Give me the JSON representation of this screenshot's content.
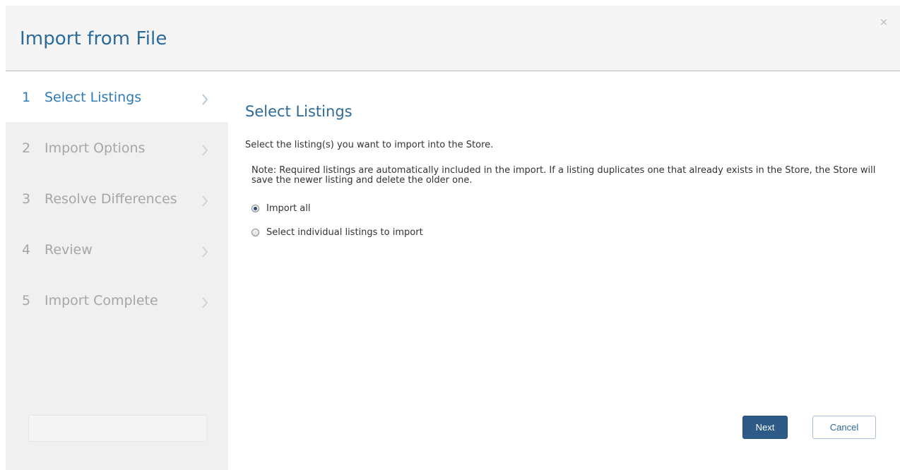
{
  "dialog": {
    "title": "Import from File",
    "close_icon": "close-icon",
    "close_glyph": "×"
  },
  "steps": [
    {
      "number": "1",
      "label": "Select Listings",
      "active": true
    },
    {
      "number": "2",
      "label": "Import Options",
      "active": false
    },
    {
      "number": "3",
      "label": "Resolve Differences",
      "active": false
    },
    {
      "number": "4",
      "label": "Review",
      "active": false
    },
    {
      "number": "5",
      "label": "Import Complete",
      "active": false
    }
  ],
  "content": {
    "title": "Select Listings",
    "intro": "Select the listing(s) you want to import into the Store.",
    "note": "Note: Required listings are automatically included in the import. If a listing duplicates one that already exists in the Store, the Store will save the newer listing and delete the older one.",
    "options": [
      {
        "label": "Import all",
        "selected": true
      },
      {
        "label": "Select individual listings to import",
        "selected": false
      }
    ]
  },
  "buttons": {
    "next": "Next",
    "cancel": "Cancel"
  },
  "colors": {
    "accent": "#2d6a9c",
    "active_step": "#2f7ab8",
    "inactive_step": "#a6a6a6",
    "primary_button": "#2d5a86",
    "sidebar_bg": "#f0f0f0",
    "header_bg": "#f5f5f5"
  }
}
